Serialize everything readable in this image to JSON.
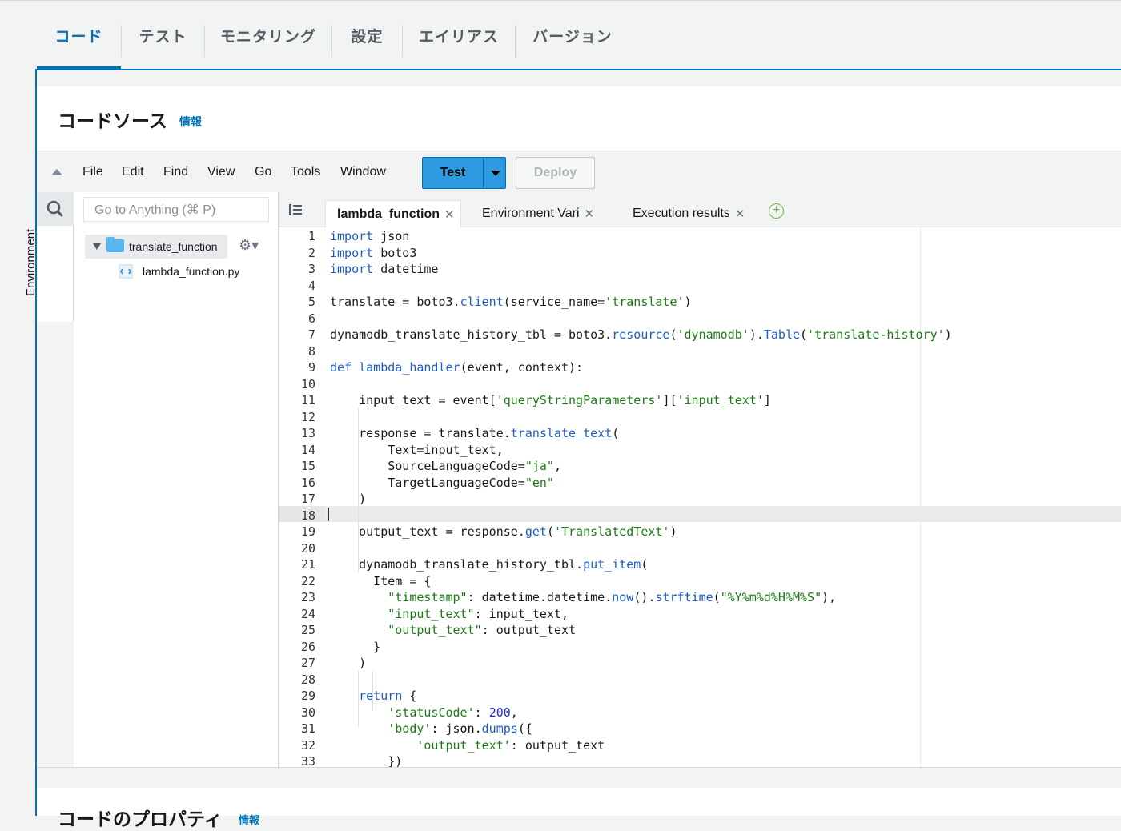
{
  "tabs": [
    {
      "label": "コード",
      "active": true
    },
    {
      "label": "テスト",
      "active": false
    },
    {
      "label": "モニタリング",
      "active": false
    },
    {
      "label": "設定",
      "active": false
    },
    {
      "label": "エイリアス",
      "active": false
    },
    {
      "label": "バージョン",
      "active": false
    }
  ],
  "code_source": {
    "title": "コードソース",
    "info_link": "情報"
  },
  "menu": {
    "items": [
      "File",
      "Edit",
      "Find",
      "View",
      "Go",
      "Tools",
      "Window"
    ],
    "test_label": "Test",
    "deploy_label": "Deploy"
  },
  "sidebar": {
    "environment_label": "Environment",
    "goto_placeholder": "Go to Anything (⌘ P)"
  },
  "filetree": {
    "folder": "translate_function",
    "file": "lambda_function.py"
  },
  "editor_tabs": [
    {
      "label": "lambda_function",
      "active": true
    },
    {
      "label": "Environment Vari",
      "active": false
    },
    {
      "label": "Execution results",
      "active": false
    }
  ],
  "code": {
    "cursor_line": 18,
    "lines": [
      "import json",
      "import boto3",
      "import datetime",
      "",
      "translate = boto3.client(service_name='translate')",
      "",
      "dynamodb_translate_history_tbl = boto3.resource('dynamodb').Table('translate-history')",
      "",
      "def lambda_handler(event, context):",
      "",
      "    input_text = event['queryStringParameters']['input_text']",
      "",
      "    response = translate.translate_text(",
      "        Text=input_text,",
      "        SourceLanguageCode=\"ja\",",
      "        TargetLanguageCode=\"en\"",
      "    )",
      "",
      "    output_text = response.get('TranslatedText')",
      "",
      "    dynamodb_translate_history_tbl.put_item(",
      "      Item = {",
      "        \"timestamp\": datetime.datetime.now().strftime(\"%Y%m%d%H%M%S\"),",
      "        \"input_text\": input_text,",
      "        \"output_text\": output_text",
      "      }",
      "    )",
      "",
      "    return {",
      "        'statusCode': 200,",
      "        'body': json.dumps({",
      "            'output_text': output_text",
      "        })"
    ]
  },
  "properties": {
    "title": "コードのプロパティ",
    "info_link": "情報"
  },
  "colors": {
    "accent": "#0073bb",
    "test_button": "#2c9be0",
    "keyword": "#1d5cc6",
    "string": "#1a7a14"
  }
}
